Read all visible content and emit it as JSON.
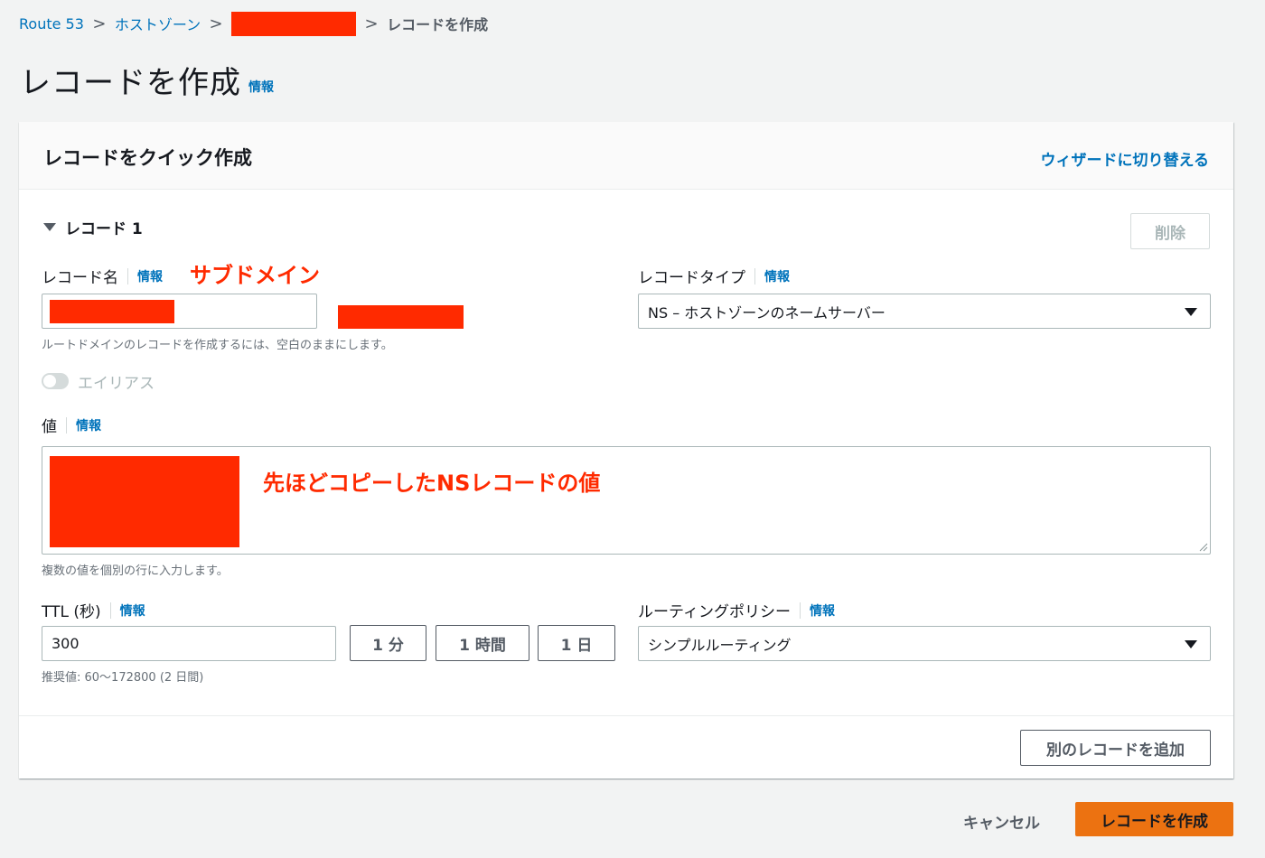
{
  "breadcrumb": {
    "items": [
      "Route 53",
      "ホストゾーン"
    ],
    "separator": ">",
    "current": "レコードを作成"
  },
  "page": {
    "title": "レコードを作成",
    "info": "情報"
  },
  "panel": {
    "title": "レコードをクイック作成",
    "wizard_link": "ウィザードに切り替える",
    "record_section": "レコード 1",
    "delete_button": "削除",
    "record_name": {
      "label": "レコード名",
      "info": "情報",
      "hint": "ルートドメインのレコードを作成するには、空白のままにします。",
      "annotation": "サブドメイン"
    },
    "record_type": {
      "label": "レコードタイプ",
      "info": "情報",
      "value": "NS – ホストゾーンのネームサーバー"
    },
    "alias": {
      "label": "エイリアス",
      "enabled": false
    },
    "value": {
      "label": "値",
      "info": "情報",
      "hint": "複数の値を個別の行に入力します。",
      "annotation": "先ほどコピーしたNSレコードの値"
    },
    "ttl": {
      "label": "TTL (秒)",
      "info": "情報",
      "value": "300",
      "hint": "推奨値: 60～172800 (2 日間)",
      "presets": [
        "1 分",
        "1 時間",
        "1 日"
      ]
    },
    "routing": {
      "label": "ルーティングポリシー",
      "info": "情報",
      "value": "シンプルルーティング"
    },
    "add_record_button": "別のレコードを追加"
  },
  "footer": {
    "cancel": "キャンセル",
    "create": "レコードを作成"
  },
  "colors": {
    "link": "#0073bb",
    "primary": "#ec7211",
    "redaction": "#ff2a00",
    "background": "#f2f3f3"
  }
}
